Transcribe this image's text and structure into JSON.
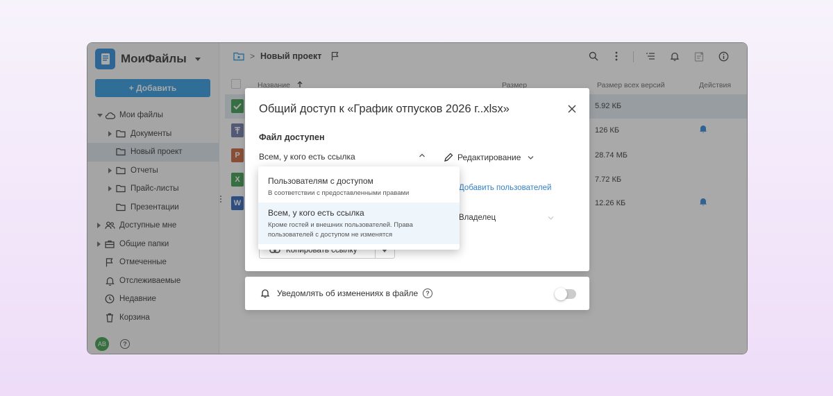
{
  "app": {
    "name": "МоиФайлы",
    "add_button": "+ Добавить",
    "avatar_initials": "AB",
    "brand_color": "#2f9ae0"
  },
  "sidebar": {
    "items": [
      {
        "label": "Мои файлы",
        "icon": "cloud-icon",
        "level": 0,
        "arrow": "open"
      },
      {
        "label": "Документы",
        "icon": "folder-icon",
        "level": 1,
        "arrow": "closed"
      },
      {
        "label": "Новый проект",
        "icon": "folder-icon",
        "level": 1,
        "arrow": "none",
        "selected": true
      },
      {
        "label": "Отчеты",
        "icon": "folder-icon",
        "level": 1,
        "arrow": "closed"
      },
      {
        "label": "Прайс-листы",
        "icon": "folder-icon",
        "level": 1,
        "arrow": "closed"
      },
      {
        "label": "Презентации",
        "icon": "folder-icon",
        "level": 1,
        "arrow": "none"
      },
      {
        "label": "Доступные мне",
        "icon": "users-icon",
        "level": 0,
        "arrow": "closed"
      },
      {
        "label": "Общие папки",
        "icon": "briefcase-icon",
        "level": 0,
        "arrow": "closed"
      },
      {
        "label": "Отмеченные",
        "icon": "flag-icon",
        "level": 0,
        "arrow": "none"
      },
      {
        "label": "Отслеживаемые",
        "icon": "bell-icon",
        "level": 0,
        "arrow": "none"
      },
      {
        "label": "Недавние",
        "icon": "clock-icon",
        "level": 0,
        "arrow": "none"
      },
      {
        "label": "Корзина",
        "icon": "trash-icon",
        "level": 0,
        "arrow": "none"
      }
    ]
  },
  "breadcrumb": {
    "current": "Новый проект"
  },
  "table": {
    "columns": {
      "name": "Название",
      "size": "Размер",
      "size_all": "Размер всех версий",
      "actions": "Действия"
    },
    "rows": [
      {
        "icon_letter": "",
        "icon_color": "#3a9c4d",
        "size_all": "5.92 КБ",
        "bell": false,
        "selected": true
      },
      {
        "icon_letter": "",
        "icon_color": "#6b78a6",
        "size_all": "126 КБ",
        "bell": true
      },
      {
        "icon_letter": "P",
        "icon_color": "#c9653a",
        "size_all": "28.74 МБ",
        "bell": false
      },
      {
        "icon_letter": "X",
        "icon_color": "#3a9c4d",
        "size_all": "7.72 КБ",
        "bell": false
      },
      {
        "icon_letter": "W",
        "icon_color": "#2e62b8",
        "size_all": "12.26 КБ",
        "bell": true
      }
    ]
  },
  "dialog": {
    "title": "Общий доступ к «График отпусков 2026 г..xlsx»",
    "section_label": "Файл доступен",
    "access_value": "Всем, у кого есть ссылка",
    "permission_value": "Редактирование",
    "add_users": "Добавить пользователей",
    "owner_role": "Владелец",
    "copy_link": "Копировать ссылку"
  },
  "dropdown": {
    "options": [
      {
        "title": "Пользователям с доступом",
        "desc": "В соответствии с предоставленными правами",
        "active": false
      },
      {
        "title": "Всем, у кого есть ссылка",
        "desc": "Кроме гостей и внешних пользователей. Права пользователей с доступом не изменятся",
        "active": true
      }
    ]
  },
  "notify": {
    "label": "Уведомлять об изменениях в файле",
    "enabled": false
  }
}
